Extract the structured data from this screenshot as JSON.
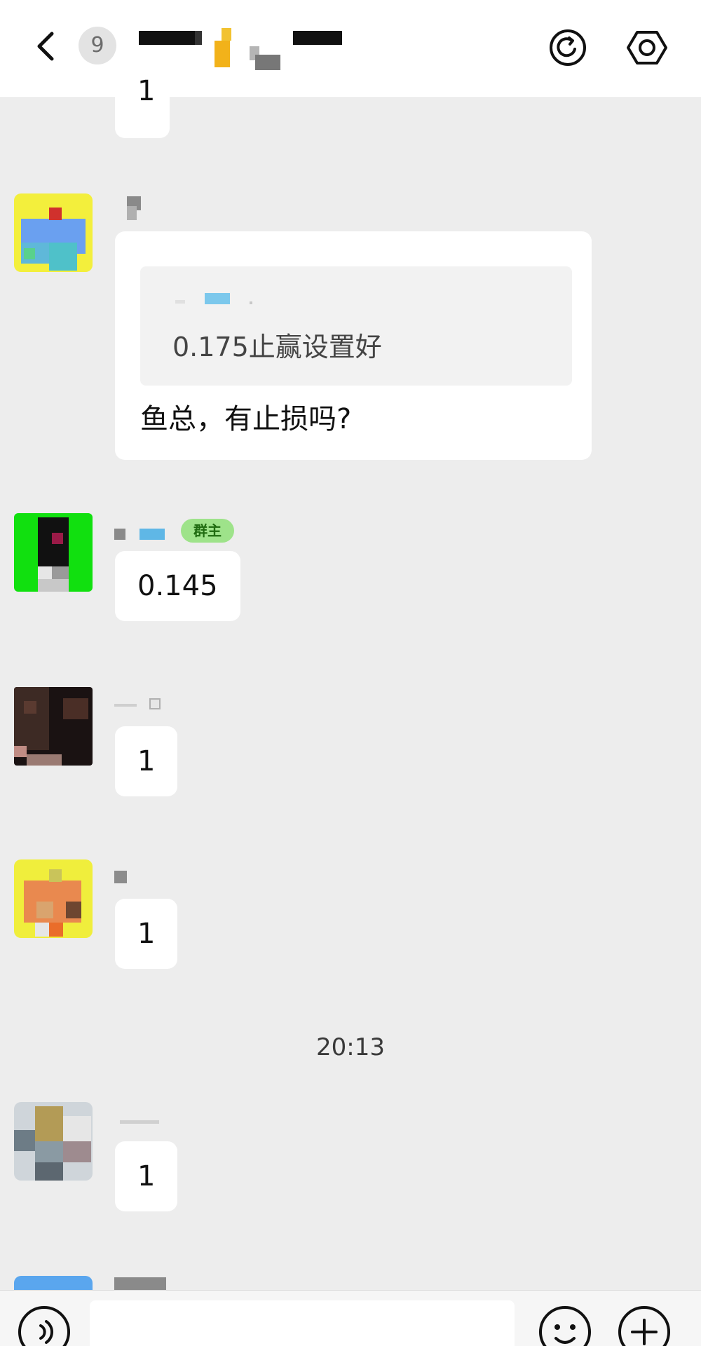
{
  "header": {
    "unread_count": "9",
    "icons": [
      "back-icon",
      "refresh-icon",
      "settings-icon"
    ],
    "title_obscured": true
  },
  "messages": [
    {
      "type": "text",
      "text": "1"
    },
    {
      "type": "reply",
      "quote_text": "0.175止赢设置好",
      "text": "鱼总，有止损吗?"
    },
    {
      "type": "text",
      "text": "0.145",
      "sender_tag": "群主"
    },
    {
      "type": "text",
      "text": "1"
    },
    {
      "type": "text",
      "text": "1"
    },
    {
      "type": "text",
      "text": "1"
    }
  ],
  "timestamp": "20:13",
  "input_bar": {
    "icons": [
      "voice-icon",
      "emoji-icon",
      "add-icon"
    ]
  },
  "colors": {
    "header_bg": "#ffffff",
    "chat_bg": "#ededed",
    "bubble_bg": "#ffffff",
    "owner_tag_bg": "#9ee38a"
  }
}
